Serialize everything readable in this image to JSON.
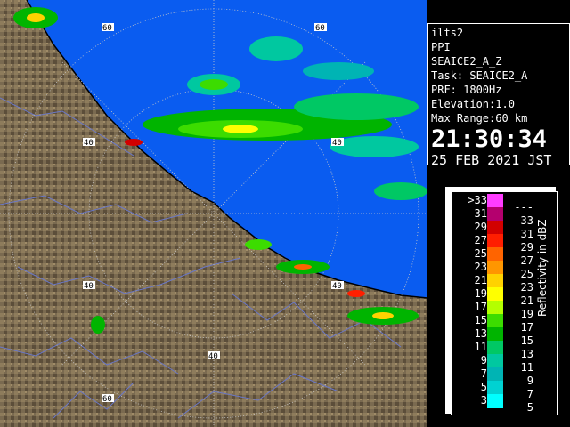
{
  "info": {
    "site": "ilts2",
    "product": "PPI",
    "name": "SEAICE2_A_Z",
    "task": "Task: SEAICE2_A",
    "prf": "PRF: 1800Hz",
    "elevation": "Elevation:1.0",
    "max_range": "Max Range:60 km",
    "time": "21:30:34",
    "date": "25 FEB 2021 JST"
  },
  "radar": {
    "range_labels": [
      "60",
      "60",
      "40",
      "40",
      "40",
      "40",
      "40",
      "60"
    ]
  },
  "legend": {
    "unit": "Reflectivity in dBZ",
    "rows": [
      {
        "lo": ">33",
        "hi": "---",
        "color": "#ff3cff"
      },
      {
        "lo": "31",
        "hi": "33",
        "color": "#b4006e"
      },
      {
        "lo": "29",
        "hi": "31",
        "color": "#d20000"
      },
      {
        "lo": "27",
        "hi": "29",
        "color": "#ff1e00"
      },
      {
        "lo": "25",
        "hi": "27",
        "color": "#ff6400"
      },
      {
        "lo": "23",
        "hi": "25",
        "color": "#ff9600"
      },
      {
        "lo": "21",
        "hi": "23",
        "color": "#ffd200"
      },
      {
        "lo": "19",
        "hi": "21",
        "color": "#ffff00"
      },
      {
        "lo": "17",
        "hi": "19",
        "color": "#b4ff00"
      },
      {
        "lo": "15",
        "hi": "17",
        "color": "#3cdc00"
      },
      {
        "lo": "13",
        "hi": "15",
        "color": "#00b400"
      },
      {
        "lo": "11",
        "hi": "13",
        "color": "#00c864"
      },
      {
        "lo": "9",
        "hi": "11",
        "color": "#00c8a0"
      },
      {
        "lo": "7",
        "hi": "9",
        "color": "#00b4b4"
      },
      {
        "lo": "5",
        "hi": "7",
        "color": "#00d2d2"
      },
      {
        "lo": "3",
        "hi": "5",
        "color": "#00ffff"
      }
    ]
  },
  "colors": {
    "sea": "#0a5cf0",
    "land": "#7a6a50",
    "rivers": "#6a78c8",
    "rings": "#c8c8c8"
  }
}
